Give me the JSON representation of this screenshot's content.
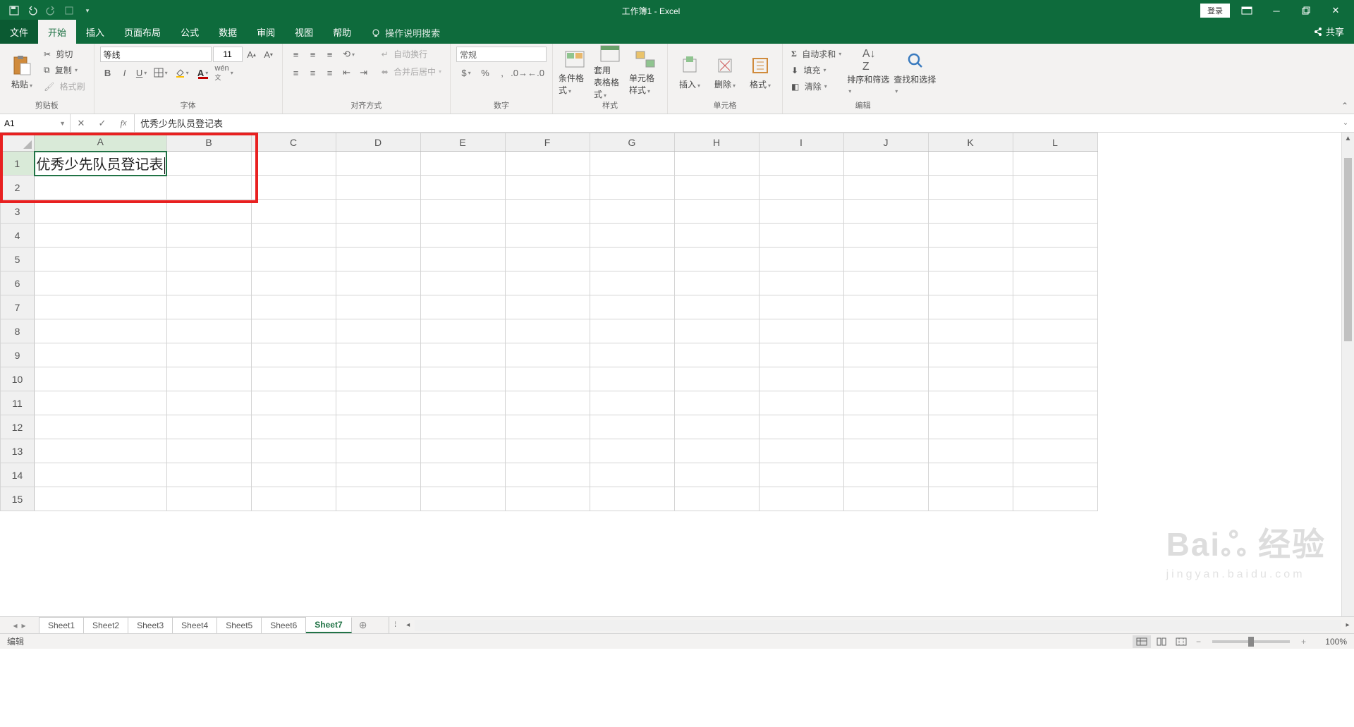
{
  "title": "工作簿1 - Excel",
  "login": "登录",
  "share": "共享",
  "menu": {
    "file": "文件",
    "tabs": [
      "开始",
      "插入",
      "页面布局",
      "公式",
      "数据",
      "审阅",
      "视图",
      "帮助"
    ],
    "active": "开始",
    "tellme": "操作说明搜索"
  },
  "ribbon": {
    "clipboard": {
      "paste": "粘贴",
      "cut": "剪切",
      "copy": "复制",
      "fmt": "格式刷",
      "label": "剪贴板"
    },
    "font": {
      "name": "等线",
      "size": "11",
      "label": "字体"
    },
    "align": {
      "wrap": "自动换行",
      "merge": "合并后居中",
      "label": "对齐方式"
    },
    "number": {
      "fmt": "常规",
      "label": "数字"
    },
    "styles": {
      "cond": "条件格式",
      "table": "套用\n表格格式",
      "cell": "单元格样式",
      "label": "样式"
    },
    "cells": {
      "insert": "插入",
      "delete": "删除",
      "format": "格式",
      "label": "单元格"
    },
    "editing": {
      "sum": "自动求和",
      "fill": "填充",
      "clear": "清除",
      "sort": "排序和筛选",
      "find": "查找和选择",
      "label": "编辑"
    }
  },
  "namebox": "A1",
  "formula": "优秀少先队员登记表",
  "sheet": {
    "cols": [
      "A",
      "B",
      "C",
      "D",
      "E",
      "F",
      "G",
      "H",
      "I",
      "J",
      "K",
      "L"
    ],
    "rows": [
      1,
      2,
      3,
      4,
      5,
      6,
      7,
      8,
      9,
      10,
      11,
      12,
      13,
      14,
      15
    ],
    "a1": "优秀少先队员登记表"
  },
  "sheettabs": [
    "Sheet1",
    "Sheet2",
    "Sheet3",
    "Sheet4",
    "Sheet5",
    "Sheet6",
    "Sheet7"
  ],
  "activeSheet": "Sheet7",
  "status": "编辑",
  "zoom": "100%",
  "watermark": {
    "main": "Baiஃ 经验",
    "sub": "jingyan.baidu.com"
  }
}
